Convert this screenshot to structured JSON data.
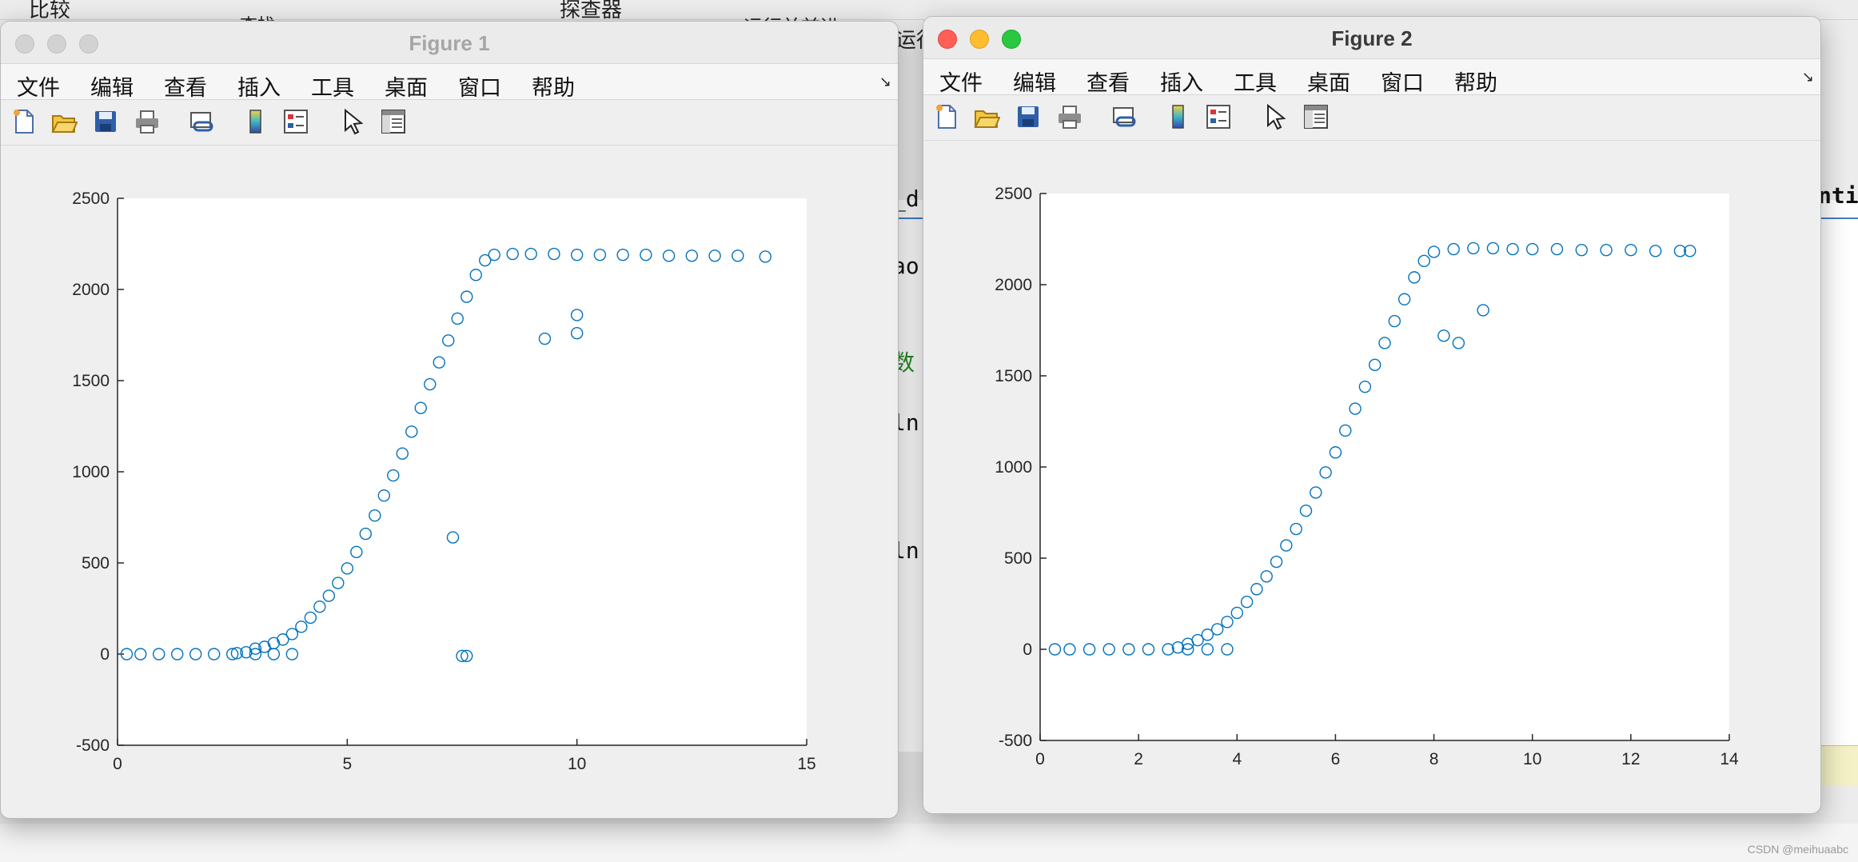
{
  "background": {
    "toolbar_labels": [
      "比较",
      "查找",
      "探查器",
      "运行并前进",
      "运行"
    ],
    "code_fragments": [
      "_d",
      "ao",
      "数",
      "ln",
      "ln"
    ],
    "right_tab_label": "ntitl",
    "watermark": "CSDN @meihuaabc"
  },
  "figures": [
    {
      "title": "Figure 1",
      "active": false,
      "menu": [
        "文件",
        "编辑",
        "查看",
        "插入",
        "工具",
        "桌面",
        "窗口",
        "帮助"
      ],
      "toolbar_icons": [
        "new-figure-icon",
        "open-file-icon",
        "save-icon",
        "print-icon",
        "link-plot-icon",
        "colorbar-icon",
        "legend-icon",
        "pointer-icon",
        "property-inspector-icon"
      ],
      "chart_data": {
        "type": "scatter",
        "marker": "open-circle",
        "color": "#0072BD",
        "xlim": [
          0,
          15
        ],
        "ylim": [
          -500,
          2500
        ],
        "xticks": [
          "0",
          "5",
          "10",
          "15"
        ],
        "yticks": [
          "-500",
          "0",
          "500",
          "1000",
          "1500",
          "2000",
          "2500"
        ],
        "grid": false,
        "points": [
          [
            0.2,
            0
          ],
          [
            0.5,
            0
          ],
          [
            0.9,
            0
          ],
          [
            1.3,
            0
          ],
          [
            1.7,
            0
          ],
          [
            2.1,
            0
          ],
          [
            2.5,
            0
          ],
          [
            3.0,
            0
          ],
          [
            3.4,
            0
          ],
          [
            3.8,
            0
          ],
          [
            2.6,
            5
          ],
          [
            2.8,
            10
          ],
          [
            3.0,
            30
          ],
          [
            3.2,
            40
          ],
          [
            3.4,
            60
          ],
          [
            3.6,
            80
          ],
          [
            3.8,
            110
          ],
          [
            4.0,
            150
          ],
          [
            4.2,
            200
          ],
          [
            4.4,
            260
          ],
          [
            4.6,
            320
          ],
          [
            4.8,
            390
          ],
          [
            5.0,
            470
          ],
          [
            5.2,
            560
          ],
          [
            5.4,
            660
          ],
          [
            5.6,
            760
          ],
          [
            5.8,
            870
          ],
          [
            6.0,
            980
          ],
          [
            6.2,
            1100
          ],
          [
            6.4,
            1220
          ],
          [
            6.6,
            1350
          ],
          [
            6.8,
            1480
          ],
          [
            7.0,
            1600
          ],
          [
            7.2,
            1720
          ],
          [
            7.4,
            1840
          ],
          [
            7.6,
            1960
          ],
          [
            7.8,
            2080
          ],
          [
            8.0,
            2160
          ],
          [
            8.2,
            2190
          ],
          [
            8.6,
            2195
          ],
          [
            9.0,
            2195
          ],
          [
            9.5,
            2195
          ],
          [
            10.0,
            2190
          ],
          [
            10.5,
            2190
          ],
          [
            11.0,
            2190
          ],
          [
            11.5,
            2190
          ],
          [
            12.0,
            2185
          ],
          [
            12.5,
            2185
          ],
          [
            13.0,
            2185
          ],
          [
            13.5,
            2185
          ],
          [
            14.1,
            2180
          ],
          [
            7.3,
            640
          ],
          [
            7.5,
            -10
          ],
          [
            7.6,
            -10
          ],
          [
            10.0,
            1860
          ],
          [
            10.0,
            1760
          ],
          [
            9.3,
            1730
          ]
        ]
      }
    },
    {
      "title": "Figure 2",
      "active": true,
      "menu": [
        "文件",
        "编辑",
        "查看",
        "插入",
        "工具",
        "桌面",
        "窗口",
        "帮助"
      ],
      "toolbar_icons": [
        "new-figure-icon",
        "open-file-icon",
        "save-icon",
        "print-icon",
        "link-plot-icon",
        "colorbar-icon",
        "legend-icon",
        "pointer-icon",
        "property-inspector-icon"
      ],
      "chart_data": {
        "type": "scatter",
        "marker": "open-circle",
        "color": "#0072BD",
        "xlim": [
          0,
          14
        ],
        "ylim": [
          -500,
          2500
        ],
        "xticks": [
          "0",
          "2",
          "4",
          "6",
          "8",
          "10",
          "12",
          "14"
        ],
        "yticks": [
          "-500",
          "0",
          "500",
          "1000",
          "1500",
          "2000",
          "2500"
        ],
        "grid": false,
        "points": [
          [
            0.3,
            0
          ],
          [
            0.6,
            0
          ],
          [
            1.0,
            0
          ],
          [
            1.4,
            0
          ],
          [
            1.8,
            0
          ],
          [
            2.2,
            0
          ],
          [
            2.6,
            0
          ],
          [
            3.0,
            0
          ],
          [
            3.4,
            0
          ],
          [
            3.8,
            0
          ],
          [
            2.8,
            10
          ],
          [
            3.0,
            30
          ],
          [
            3.2,
            50
          ],
          [
            3.4,
            80
          ],
          [
            3.6,
            110
          ],
          [
            3.8,
            150
          ],
          [
            4.0,
            200
          ],
          [
            4.2,
            260
          ],
          [
            4.4,
            330
          ],
          [
            4.6,
            400
          ],
          [
            4.8,
            480
          ],
          [
            5.0,
            570
          ],
          [
            5.2,
            660
          ],
          [
            5.4,
            760
          ],
          [
            5.6,
            860
          ],
          [
            5.8,
            970
          ],
          [
            6.0,
            1080
          ],
          [
            6.2,
            1200
          ],
          [
            6.4,
            1320
          ],
          [
            6.6,
            1440
          ],
          [
            6.8,
            1560
          ],
          [
            7.0,
            1680
          ],
          [
            7.2,
            1800
          ],
          [
            7.4,
            1920
          ],
          [
            7.6,
            2040
          ],
          [
            7.8,
            2130
          ],
          [
            8.0,
            2180
          ],
          [
            8.4,
            2195
          ],
          [
            8.8,
            2200
          ],
          [
            9.2,
            2200
          ],
          [
            9.6,
            2195
          ],
          [
            10.0,
            2195
          ],
          [
            10.5,
            2195
          ],
          [
            11.0,
            2190
          ],
          [
            11.5,
            2190
          ],
          [
            12.0,
            2190
          ],
          [
            12.5,
            2185
          ],
          [
            13.0,
            2185
          ],
          [
            13.2,
            2185
          ],
          [
            8.2,
            1720
          ],
          [
            8.5,
            1680
          ],
          [
            9.0,
            1860
          ]
        ]
      }
    }
  ]
}
